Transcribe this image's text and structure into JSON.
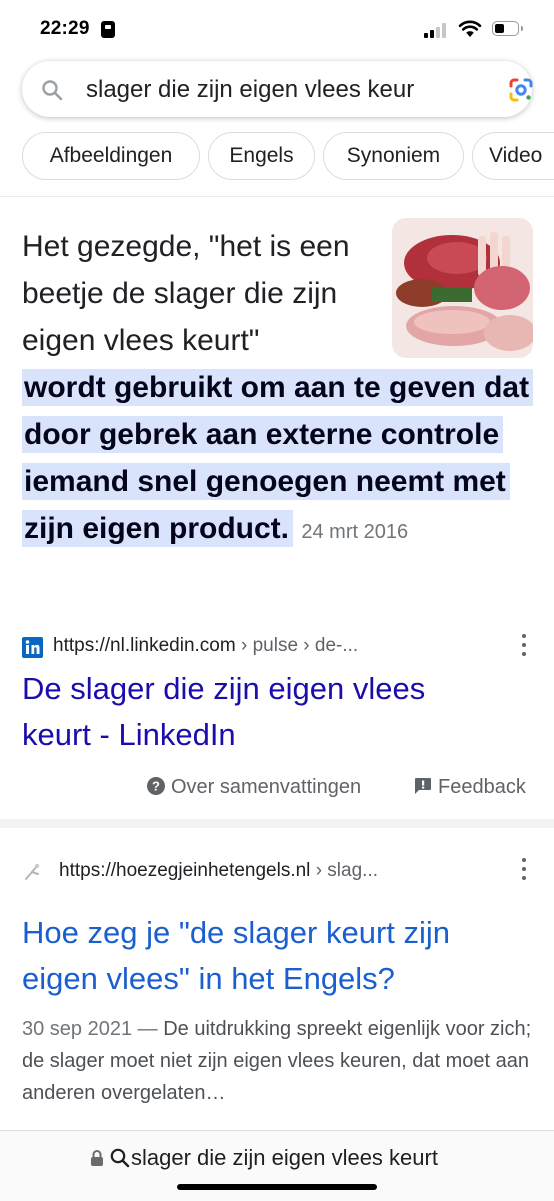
{
  "status_bar": {
    "time": "22:29",
    "battery_level": 0.45,
    "signal_bars": 2
  },
  "search": {
    "query": "slager die zijn eigen vlees keur"
  },
  "chips": [
    "Afbeeldingen",
    "Engels",
    "Synoniem",
    "Video"
  ],
  "featured_snippet": {
    "intro": "Het gezegde, \"het is een beetje de slager die zijn eigen vlees keurt\"",
    "highlight": "wordt gebruikt om aan te geven dat door gebrek aan externe controle iemand snel genoegen neemt met zijn eigen product.",
    "date": "24 mrt 2016",
    "source_domain": "https://nl.linkedin.com",
    "source_path": " › pulse › de-...",
    "result_title": "De slager die zijn eigen vlees keurt - LinkedIn",
    "about_label": "Over samenvattingen",
    "feedback_label": "Feedback"
  },
  "result2": {
    "source_domain": "https://hoezegjeinhetengels.nl",
    "source_path": " › slag...",
    "title": "Hoe zeg je \"de slager keurt zijn eigen vlees\" in het Engels?",
    "date": "30 sep 2021",
    "separator": " — ",
    "snippet": "De uitdrukking spreekt eigenlijk voor zich; de slager moet niet zijn eigen vlees keuren, dat moet aan anderen overgelaten…"
  },
  "bottom_bar": {
    "address": "slager die zijn eigen vlees keurt"
  },
  "colors": {
    "link": "#1a0dab",
    "highlight": "#d9e3fb",
    "linkedin": "#0a66c2"
  }
}
